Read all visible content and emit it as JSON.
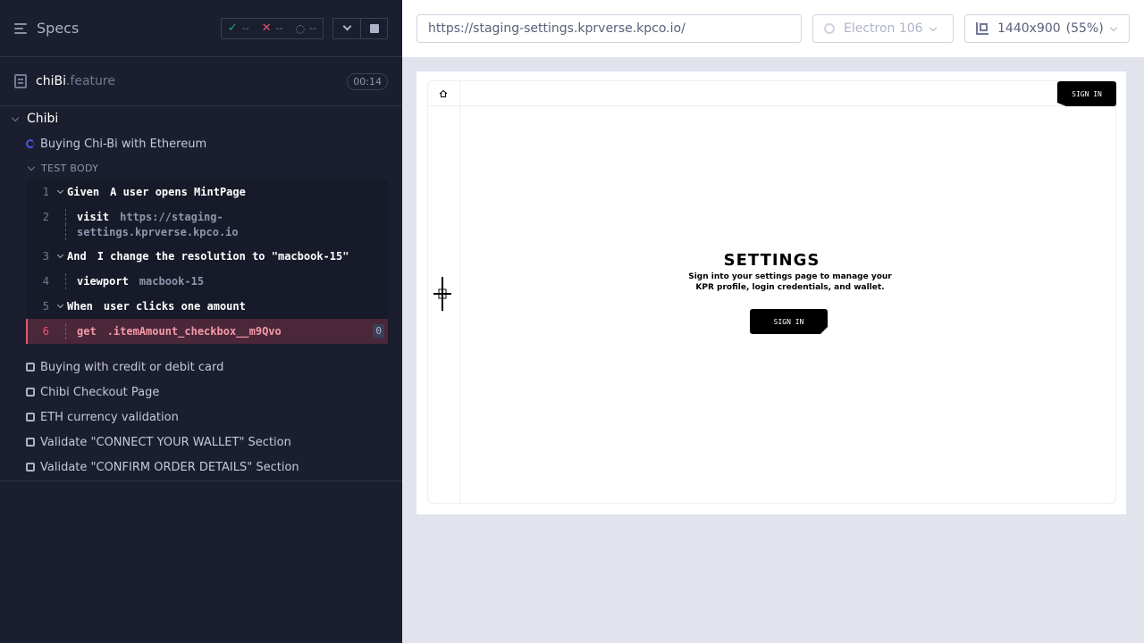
{
  "reporter": {
    "header": {
      "title": "Specs",
      "passed": "--",
      "failed": "--",
      "pending": "--"
    },
    "spec": {
      "name": "chiBi",
      "ext": ".feature",
      "duration": "00:14"
    },
    "suite": "Chibi",
    "running_test": "Buying Chi-Bi with Ethereum",
    "test_body_label": "TEST BODY",
    "commands": [
      {
        "num": "1",
        "kw": "Given",
        "text": "A user opens MintPage"
      },
      {
        "num": "2",
        "kw": "visit",
        "value": "https://staging-settings.kprverse.kpco.io",
        "value_line1": "https://staging-",
        "value_line2": "settings.kprverse.kpco.io"
      },
      {
        "num": "3",
        "kw": "And",
        "text": "I change the resolution to \"macbook-15\""
      },
      {
        "num": "4",
        "kw": "viewport",
        "value": "macbook-15"
      },
      {
        "num": "5",
        "kw": "When",
        "text": "user clicks one amount"
      },
      {
        "num": "6",
        "kw": "get",
        "value": ".itemAmount_checkbox__m9Qvo",
        "count": "0",
        "status": "failed"
      }
    ],
    "other_tests": [
      "Buying with credit or debit card",
      "Chibi Checkout Page",
      "ETH currency validation",
      "Validate \"CONNECT YOUR WALLET\" Section",
      "Validate \"CONFIRM ORDER DETAILS\" Section"
    ]
  },
  "aut": {
    "url": "https://staging-settings.kprverse.kpco.io/",
    "browser": "Electron 106",
    "viewport_dims": "1440x900",
    "viewport_scale": "(55%)",
    "site": {
      "signin_top": "SIGN IN",
      "title": "SETTINGS",
      "description": "Sign into your settings page to manage your KPR profile, login credentials, and wallet.",
      "signin_button": "SIGN IN"
    }
  },
  "colors": {
    "reporter_bg": "#1b1e2e",
    "pass": "#1fa971",
    "fail": "#e45770",
    "running": "#4956e3"
  }
}
